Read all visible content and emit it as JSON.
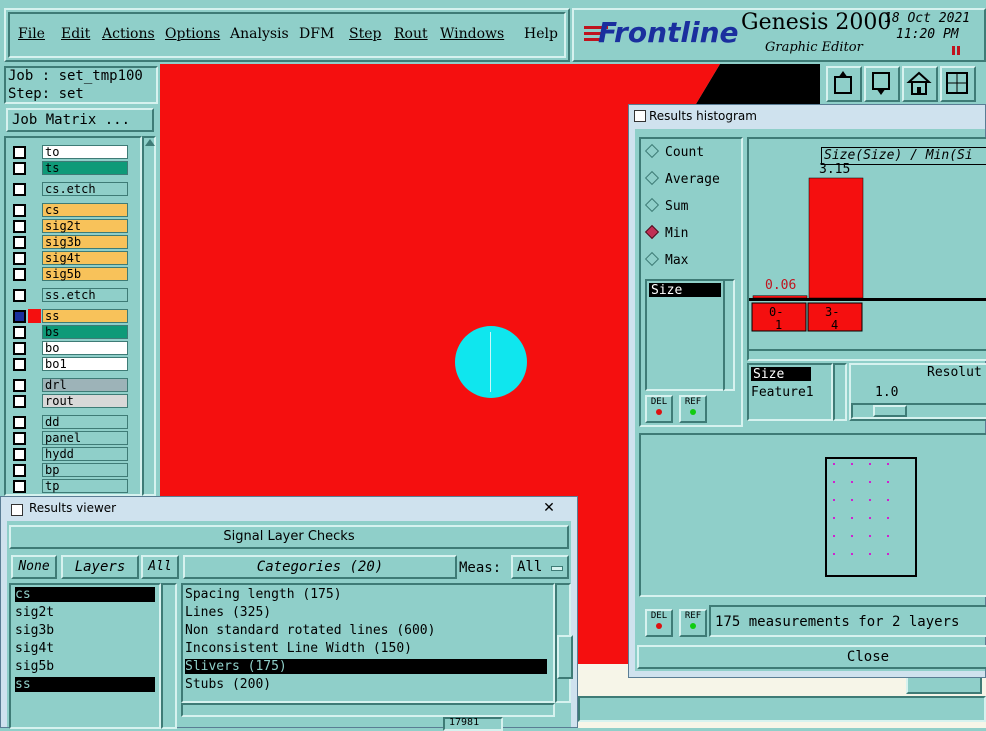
{
  "menu": [
    "File",
    "Edit",
    "Actions",
    "Options",
    "Analysis",
    "DFM",
    "Step",
    "Rout",
    "Windows",
    "Help"
  ],
  "brand": {
    "logo": "Frontline",
    "product": "Genesis 2000",
    "subtitle": "Graphic Editor",
    "date": "18 Oct 2021",
    "time": "11:20 PM"
  },
  "job": {
    "job_label": "Job : set_tmp100",
    "step_label": "Step: set",
    "matrix_button": "Job Matrix ..."
  },
  "layers": [
    {
      "name": "to",
      "color": "#ffffff"
    },
    {
      "name": "ts",
      "color": "#0e9a78"
    },
    {
      "name": "cs.etch",
      "color": "#8fcfc9"
    },
    {
      "name": "cs",
      "color": "#f8c25a"
    },
    {
      "name": "sig2t",
      "color": "#f8c25a"
    },
    {
      "name": "sig3b",
      "color": "#f8c25a"
    },
    {
      "name": "sig4t",
      "color": "#f8c25a"
    },
    {
      "name": "sig5b",
      "color": "#f8c25a"
    },
    {
      "name": "ss.etch",
      "color": "#8fcfc9"
    },
    {
      "name": "ss",
      "color": "#f8c25a"
    },
    {
      "name": "bs",
      "color": "#0e9a78"
    },
    {
      "name": "bo",
      "color": "#ffffff"
    },
    {
      "name": "bo1",
      "color": "#ffffff"
    },
    {
      "name": "drl",
      "color": "#9db3b8"
    },
    {
      "name": "rout",
      "color": "#d8d8d8"
    },
    {
      "name": "dd",
      "color": "#8fcfc9"
    },
    {
      "name": "panel",
      "color": "#8fcfc9"
    },
    {
      "name": "hydd",
      "color": "#8fcfc9"
    },
    {
      "name": "bp",
      "color": "#8fcfc9"
    },
    {
      "name": "tp",
      "color": "#8fcfc9"
    }
  ],
  "histogram": {
    "title": "Results histogram",
    "options": [
      {
        "label": "Count",
        "selected": false
      },
      {
        "label": "Average",
        "selected": false
      },
      {
        "label": "Sum",
        "selected": false
      },
      {
        "label": "Min",
        "selected": true
      },
      {
        "label": "Max",
        "selected": false
      }
    ],
    "list_item": "Size",
    "del": "DEL",
    "ref": "REF",
    "chart_header": "Size(Size) / Min(Si",
    "max_label": "3.15",
    "min_label": "0.06",
    "bins": [
      "0-\n1",
      "3-\n4"
    ],
    "attr_list": [
      "Size",
      "Feature1"
    ],
    "resolution_label": "Resolut",
    "resolution_value": "1.0",
    "status": "175 measurements for 2 layers",
    "close": "Close"
  },
  "chart_data": {
    "type": "bar",
    "categories": [
      "0-1",
      "3-4"
    ],
    "values": [
      0.06,
      3.15
    ],
    "title": "Size(Size) / Min(Si"
  },
  "viewer": {
    "title": "Results viewer",
    "header": "Signal Layer Checks",
    "none_btn": "None",
    "layers_btn": "Layers",
    "all_btn": "All",
    "categories_btn": "Categories (20)",
    "meas_label": "Meas:",
    "meas_value": "All",
    "layers": [
      {
        "name": "cs",
        "selected": true
      },
      {
        "name": "sig2t",
        "selected": false
      },
      {
        "name": "sig3b",
        "selected": false
      },
      {
        "name": "sig4t",
        "selected": false
      },
      {
        "name": "sig5b",
        "selected": false
      },
      {
        "name": "ss",
        "selected": true
      }
    ],
    "categories": [
      {
        "name": "Spacing length (175)",
        "selected": false
      },
      {
        "name": "Lines (325)",
        "selected": false
      },
      {
        "name": "Non standard rotated lines (600)",
        "selected": false
      },
      {
        "name": "Inconsistent Line Width (150)",
        "selected": false
      },
      {
        "name": "Slivers (175)",
        "selected": true
      },
      {
        "name": "Stubs (200)",
        "selected": false
      }
    ],
    "bottom_value": "17981"
  }
}
